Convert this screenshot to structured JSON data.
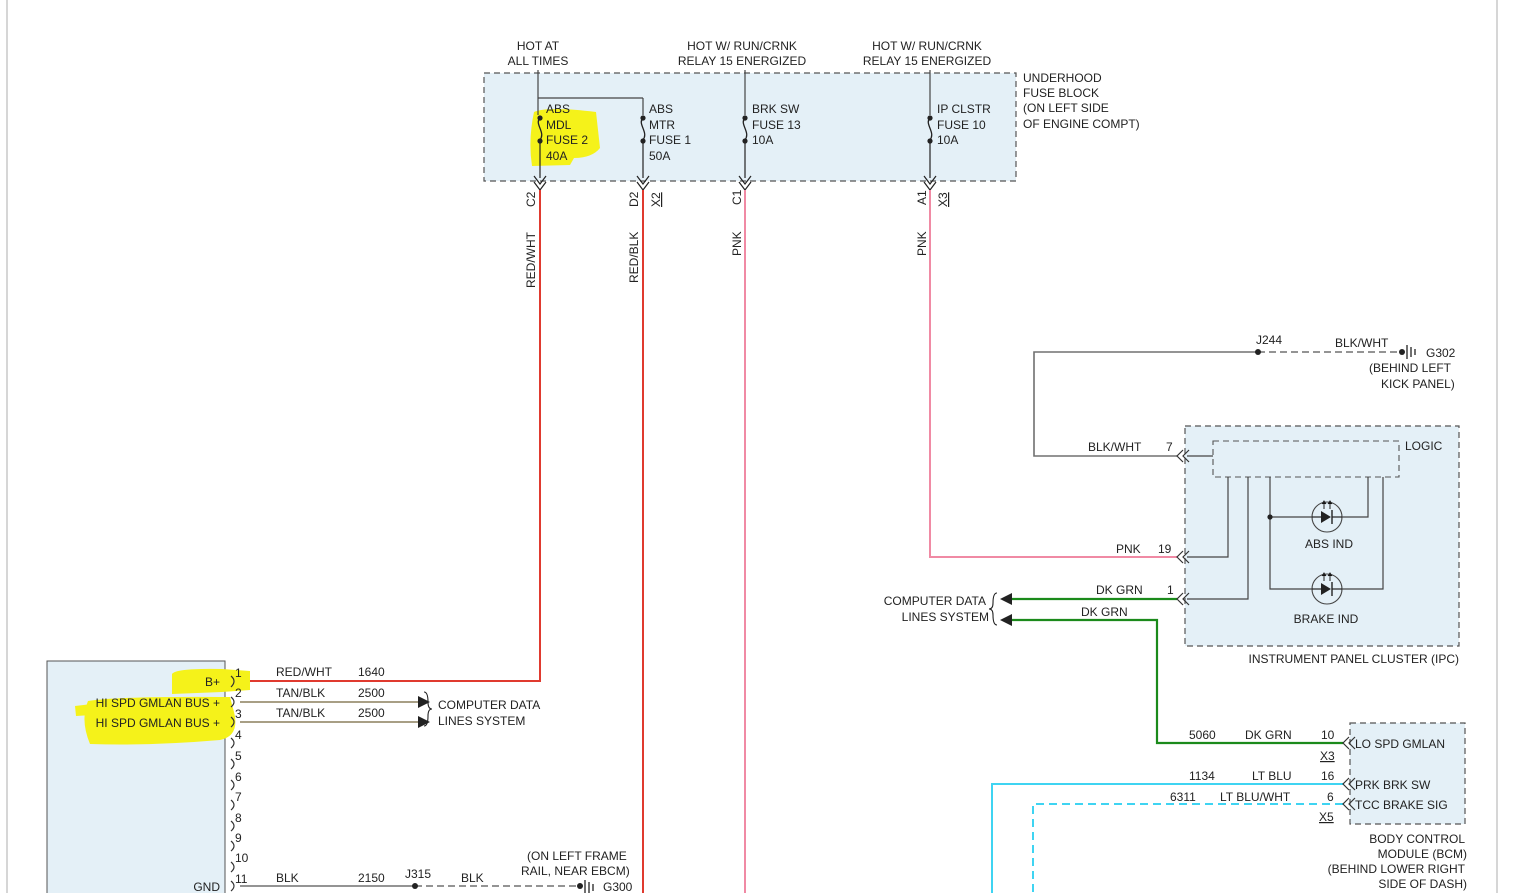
{
  "fuse_block": {
    "headers": [
      [
        "HOT AT",
        "ALL TIMES"
      ],
      [
        "HOT W/ RUN/CRNK",
        "RELAY 15 ENERGIZED"
      ],
      [
        "HOT W/ RUN/CRNK",
        "RELAY 15 ENERGIZED"
      ]
    ],
    "title": [
      "UNDERHOOD",
      "FUSE BLOCK",
      "(ON LEFT SIDE",
      "OF ENGINE COMPT)"
    ],
    "fuses": [
      {
        "lines": [
          "ABS",
          "MDL",
          "FUSE 2",
          "40A"
        ],
        "terminal": "C2",
        "connector": "",
        "wire_color": "RED/WHT",
        "highlight": true
      },
      {
        "lines": [
          "ABS",
          "MTR",
          "FUSE 1",
          "50A"
        ],
        "terminal": "D2",
        "connector": "X2",
        "wire_color": "RED/BLK",
        "highlight": false
      },
      {
        "lines": [
          "BRK SW",
          "FUSE 13",
          "10A"
        ],
        "terminal": "C1",
        "connector": "",
        "wire_color": "PNK",
        "highlight": false
      },
      {
        "lines": [
          "IP CLSTR",
          "FUSE 10",
          "10A"
        ],
        "terminal": "A1",
        "connector": "X3",
        "wire_color": "PNK",
        "highlight": false
      }
    ]
  },
  "ground_g302": {
    "splice": "J244",
    "wire": "BLK/WHT",
    "ground": "G302",
    "location": [
      "(BEHIND LEFT",
      "KICK PANEL)"
    ]
  },
  "ipc": {
    "name": "INSTRUMENT PANEL CLUSTER (IPC)",
    "logic_label": "LOGIC",
    "indicators": [
      "ABS IND",
      "BRAKE IND"
    ],
    "pins": [
      {
        "wire": "BLK/WHT",
        "pin": "7"
      },
      {
        "wire": "PNK",
        "pin": "19"
      },
      {
        "wire": "DK GRN",
        "pin": "1"
      }
    ]
  },
  "computer_data_right": {
    "label": [
      "COMPUTER DATA",
      "LINES SYSTEM"
    ],
    "wire2": "DK GRN"
  },
  "bcm": {
    "name": [
      "BODY CONTROL",
      "MODULE (BCM)",
      "(BEHIND LOWER RIGHT",
      "SIDE OF DASH)"
    ],
    "pins": [
      {
        "circuit": "5060",
        "wire": "DK GRN",
        "pin": "10",
        "label": "LO SPD GMLAN",
        "connector": "X3"
      },
      {
        "circuit": "1134",
        "wire": "LT BLU",
        "pin": "16",
        "label": "PRK BRK SW",
        "connector": ""
      },
      {
        "circuit": "6311",
        "wire": "LT BLU/WHT",
        "pin": "6",
        "label": "TCC BRAKE SIG",
        "connector": "X5"
      }
    ]
  },
  "ebcm": {
    "pins": [
      {
        "num": "1",
        "label": "B+",
        "wire": "RED/WHT",
        "circuit": "1640"
      },
      {
        "num": "2",
        "label": "HI SPD GMLAN BUS +",
        "wire": "TAN/BLK",
        "circuit": "2500"
      },
      {
        "num": "3",
        "label": "HI SPD GMLAN BUS +",
        "wire": "TAN/BLK",
        "circuit": "2500"
      },
      {
        "num": "4",
        "label": ""
      },
      {
        "num": "5",
        "label": ""
      },
      {
        "num": "6",
        "label": ""
      },
      {
        "num": "7",
        "label": ""
      },
      {
        "num": "8",
        "label": ""
      },
      {
        "num": "9",
        "label": ""
      },
      {
        "num": "10",
        "label": ""
      },
      {
        "num": "11",
        "label": "GND",
        "wire": "BLK",
        "circuit": "2150"
      }
    ]
  },
  "computer_data_left": {
    "label": [
      "COMPUTER DATA",
      "LINES SYSTEM"
    ]
  },
  "ground_g300": {
    "splice": "J315",
    "wire": "BLK",
    "ground": "G300",
    "location": [
      "(ON LEFT FRAME",
      "RAIL, NEAR EBCM)"
    ]
  },
  "colors": {
    "red": "#e03a2f",
    "pink": "#f08aa4",
    "green": "#1b8a1b",
    "tan": "#a89f85",
    "gray": "#707070",
    "cyan": "#3fd4f2",
    "highlight": "#f5f21a",
    "module_fill": "#e4f0f7"
  }
}
